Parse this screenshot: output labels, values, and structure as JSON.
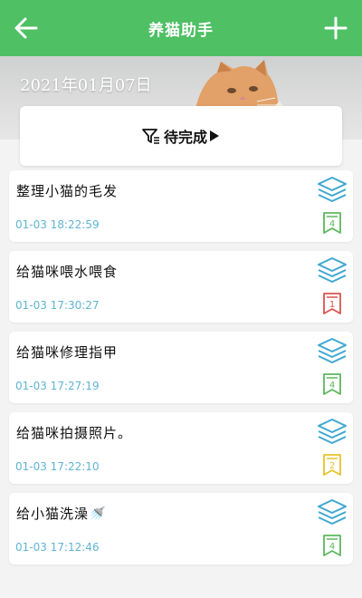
{
  "header": {
    "title": "养猫助手",
    "back_icon": "arrow-left-icon",
    "add_icon": "plus-icon",
    "color": "#4fc064"
  },
  "banner": {
    "date": "2021年01月07日"
  },
  "filter": {
    "label": "待完成",
    "icon": "filter-icon",
    "arrow_icon": "play-arrow-icon"
  },
  "tasks": [
    {
      "name": "整理小猫的毛发",
      "time": "01-03 18:22:59",
      "priority": "4",
      "priority_color": "#5cb85c"
    },
    {
      "name": "给猫咪喂水喂食",
      "time": "01-03 17:30:27",
      "priority": "1",
      "priority_color": "#d9534f"
    },
    {
      "name": "给猫咪修理指甲",
      "time": "01-03 17:27:19",
      "priority": "4",
      "priority_color": "#5cb85c"
    },
    {
      "name": "给猫咪拍摄照片。",
      "time": "01-03 17:22:10",
      "priority": "2",
      "priority_color": "#e6c22b"
    },
    {
      "name": "给小猫洗澡🚿",
      "time": "01-03 17:12:46",
      "priority": "4",
      "priority_color": "#5cb85c"
    }
  ],
  "colors": {
    "time_text": "#5fb4d4",
    "stack_icon": "#3fa8d0"
  }
}
